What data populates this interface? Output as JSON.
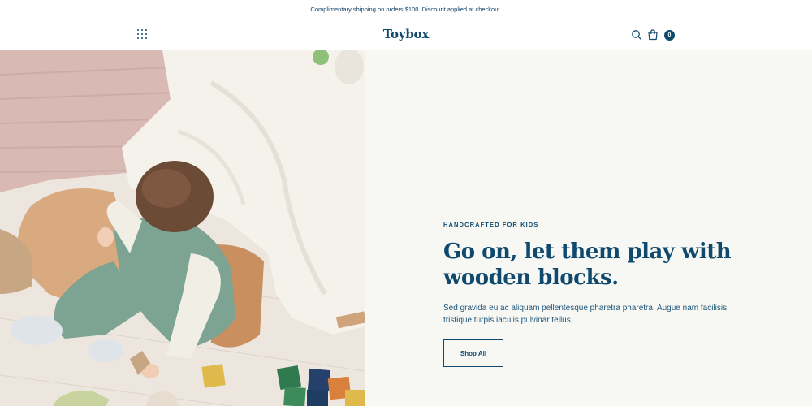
{
  "announcement": {
    "text": "Complimentary shipping on orders $100. Discount applied at checkout."
  },
  "header": {
    "logo": "Toybox",
    "cart_count": "0",
    "icons": [
      "grid-menu-icon",
      "search-icon",
      "shopping-bag-icon"
    ]
  },
  "hero": {
    "eyebrow": "HANDCRAFTED FOR KIDS",
    "headline": "Go on, let them play with wooden blocks.",
    "description": "Sed gravida eu ac aliquam pellentesque pharetra pharetra. Augue nam facilisis tristique turpis iaculis pulvinar tellus.",
    "cta_label": "Shop All"
  },
  "colors": {
    "brand": "#0f4a6e",
    "hero_background": "#f7f8f3",
    "page_background": "#ffffff"
  }
}
